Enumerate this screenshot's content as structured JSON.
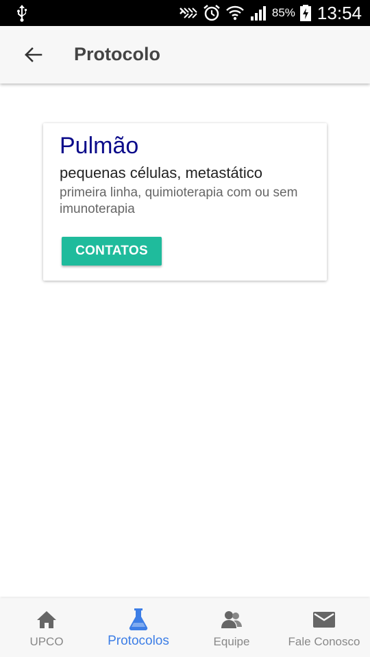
{
  "status_bar": {
    "battery": "85%",
    "time": "13:54",
    "icons": [
      "usb-icon",
      "nfc-icon",
      "alarm-icon",
      "wifi-icon",
      "signal-icon",
      "battery-charging-icon"
    ]
  },
  "app_bar": {
    "back_icon": "arrow-back-icon",
    "title": "Protocolo"
  },
  "card": {
    "title": "Pulmão",
    "subtitle": "pequenas células, metastático",
    "description": "primeira linha, quimioterapia com ou sem imunoterapia",
    "button_label": "CONTATOS"
  },
  "bottom_nav": {
    "items": [
      {
        "label": "UPCO",
        "icon": "home-icon"
      },
      {
        "label": "Protocolos",
        "icon": "flask-icon",
        "active": true
      },
      {
        "label": "Equipe",
        "icon": "people-icon"
      },
      {
        "label": "Fale Conosco",
        "icon": "mail-icon"
      }
    ]
  },
  "colors": {
    "accent": "#1fbb9c",
    "active_tab": "#3d7ee6",
    "card_title": "#0b0b8a",
    "status_bar": "#000000"
  }
}
